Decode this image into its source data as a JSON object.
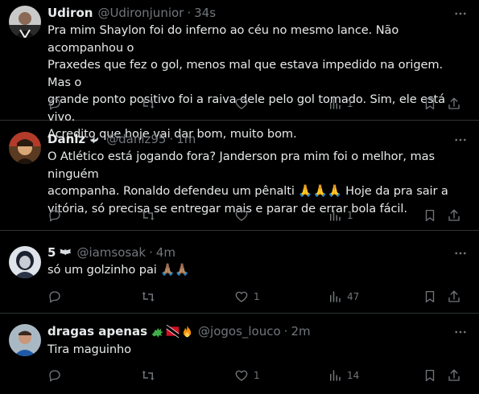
{
  "tweets": [
    {
      "name": "Udiron",
      "handle": "@Udironjunior",
      "time": "34s",
      "lines": [
        "Pra mim Shaylon foi do inferno ao céu no mesmo lance. Não acompanhou o",
        "Praxedes que fez o gol, menos mal que estava impedido na origem. Mas o",
        "grande ponto positivo foi a raiva dele pelo gol tomado. Sim, ele está vivo.",
        "Acredito que hoje vai dar bom, muito bom."
      ],
      "replies": "",
      "retweets": "",
      "likes": "",
      "views": "1"
    },
    {
      "name": "Danlz",
      "handle": "@danlz95",
      "time": "1m",
      "lines": [
        "O Atlético está jogando fora? Janderson pra mim foi o melhor, mas ninguém",
        "acompanha. Ronaldo defendeu um pênalti 🙏🙏🙏 Hoje da pra sair a",
        "vitória, só precisa se entregar mais e parar de errar bola fácil."
      ],
      "replies": "",
      "retweets": "",
      "likes": "",
      "views": "1"
    },
    {
      "name": "5",
      "handle": "@iamsosak",
      "time": "4m",
      "lines": [
        "só um golzinho pai 🙏🏽🙏🏽"
      ],
      "replies": "",
      "retweets": "",
      "likes": "1",
      "views": "47"
    },
    {
      "name": "dragas apenas",
      "handle": "@jogos_louco",
      "time": "2m",
      "lines": [
        "Tira maguinho"
      ],
      "replies": "",
      "retweets": "",
      "likes": "1",
      "views": "14"
    }
  ],
  "icons": {
    "reply": "reply-icon",
    "retweet": "retweet-icon",
    "like": "like-icon",
    "views": "views-icon",
    "bookmark": "bookmark-icon",
    "share": "share-icon",
    "more": "more-icon"
  },
  "colors": {
    "background": "#000000",
    "text": "#e7e9ea",
    "muted": "#71767b",
    "divider": "#2f3336"
  }
}
